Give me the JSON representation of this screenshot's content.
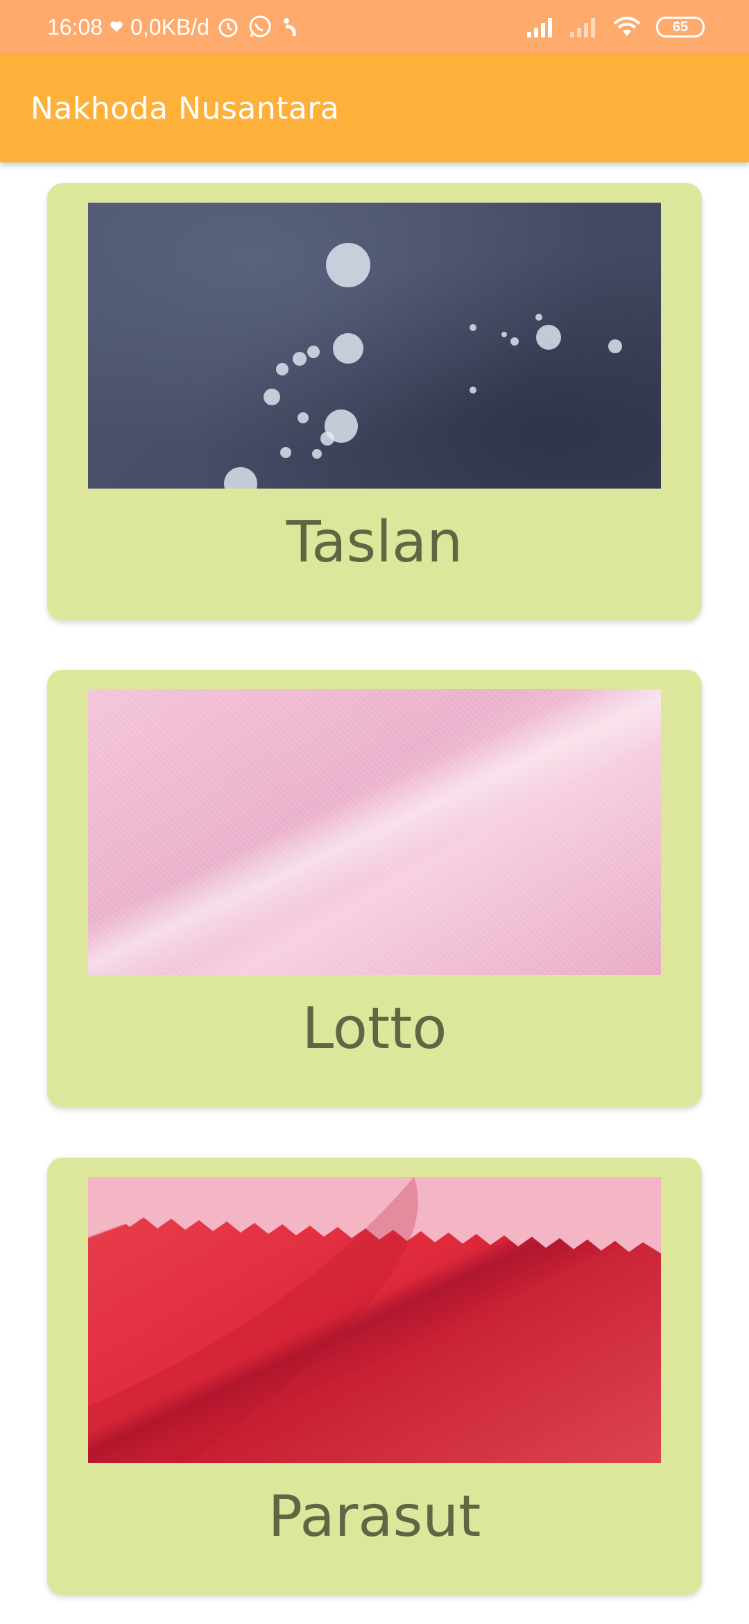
{
  "status_bar": {
    "time": "16:08",
    "data_speed": "0,0KB/d",
    "battery": "65",
    "icons": [
      "heart-icon",
      "alarm-icon",
      "whatsapp-icon",
      "notification-icon",
      "signal-icon",
      "signal-weak-icon",
      "wifi-icon",
      "battery-icon"
    ]
  },
  "app_bar": {
    "title": "Nakhoda Nusantara"
  },
  "cards": [
    {
      "label": "Taslan",
      "image": "taslan-fabric-image"
    },
    {
      "label": "Lotto",
      "image": "lotto-fabric-image"
    },
    {
      "label": "Parasut",
      "image": "parasut-fabric-image"
    }
  ],
  "colors": {
    "status_bar": "#fdaa6c",
    "app_bar": "#fdb03a",
    "card_bg": "#dde79b",
    "card_label": "#5e6644"
  }
}
